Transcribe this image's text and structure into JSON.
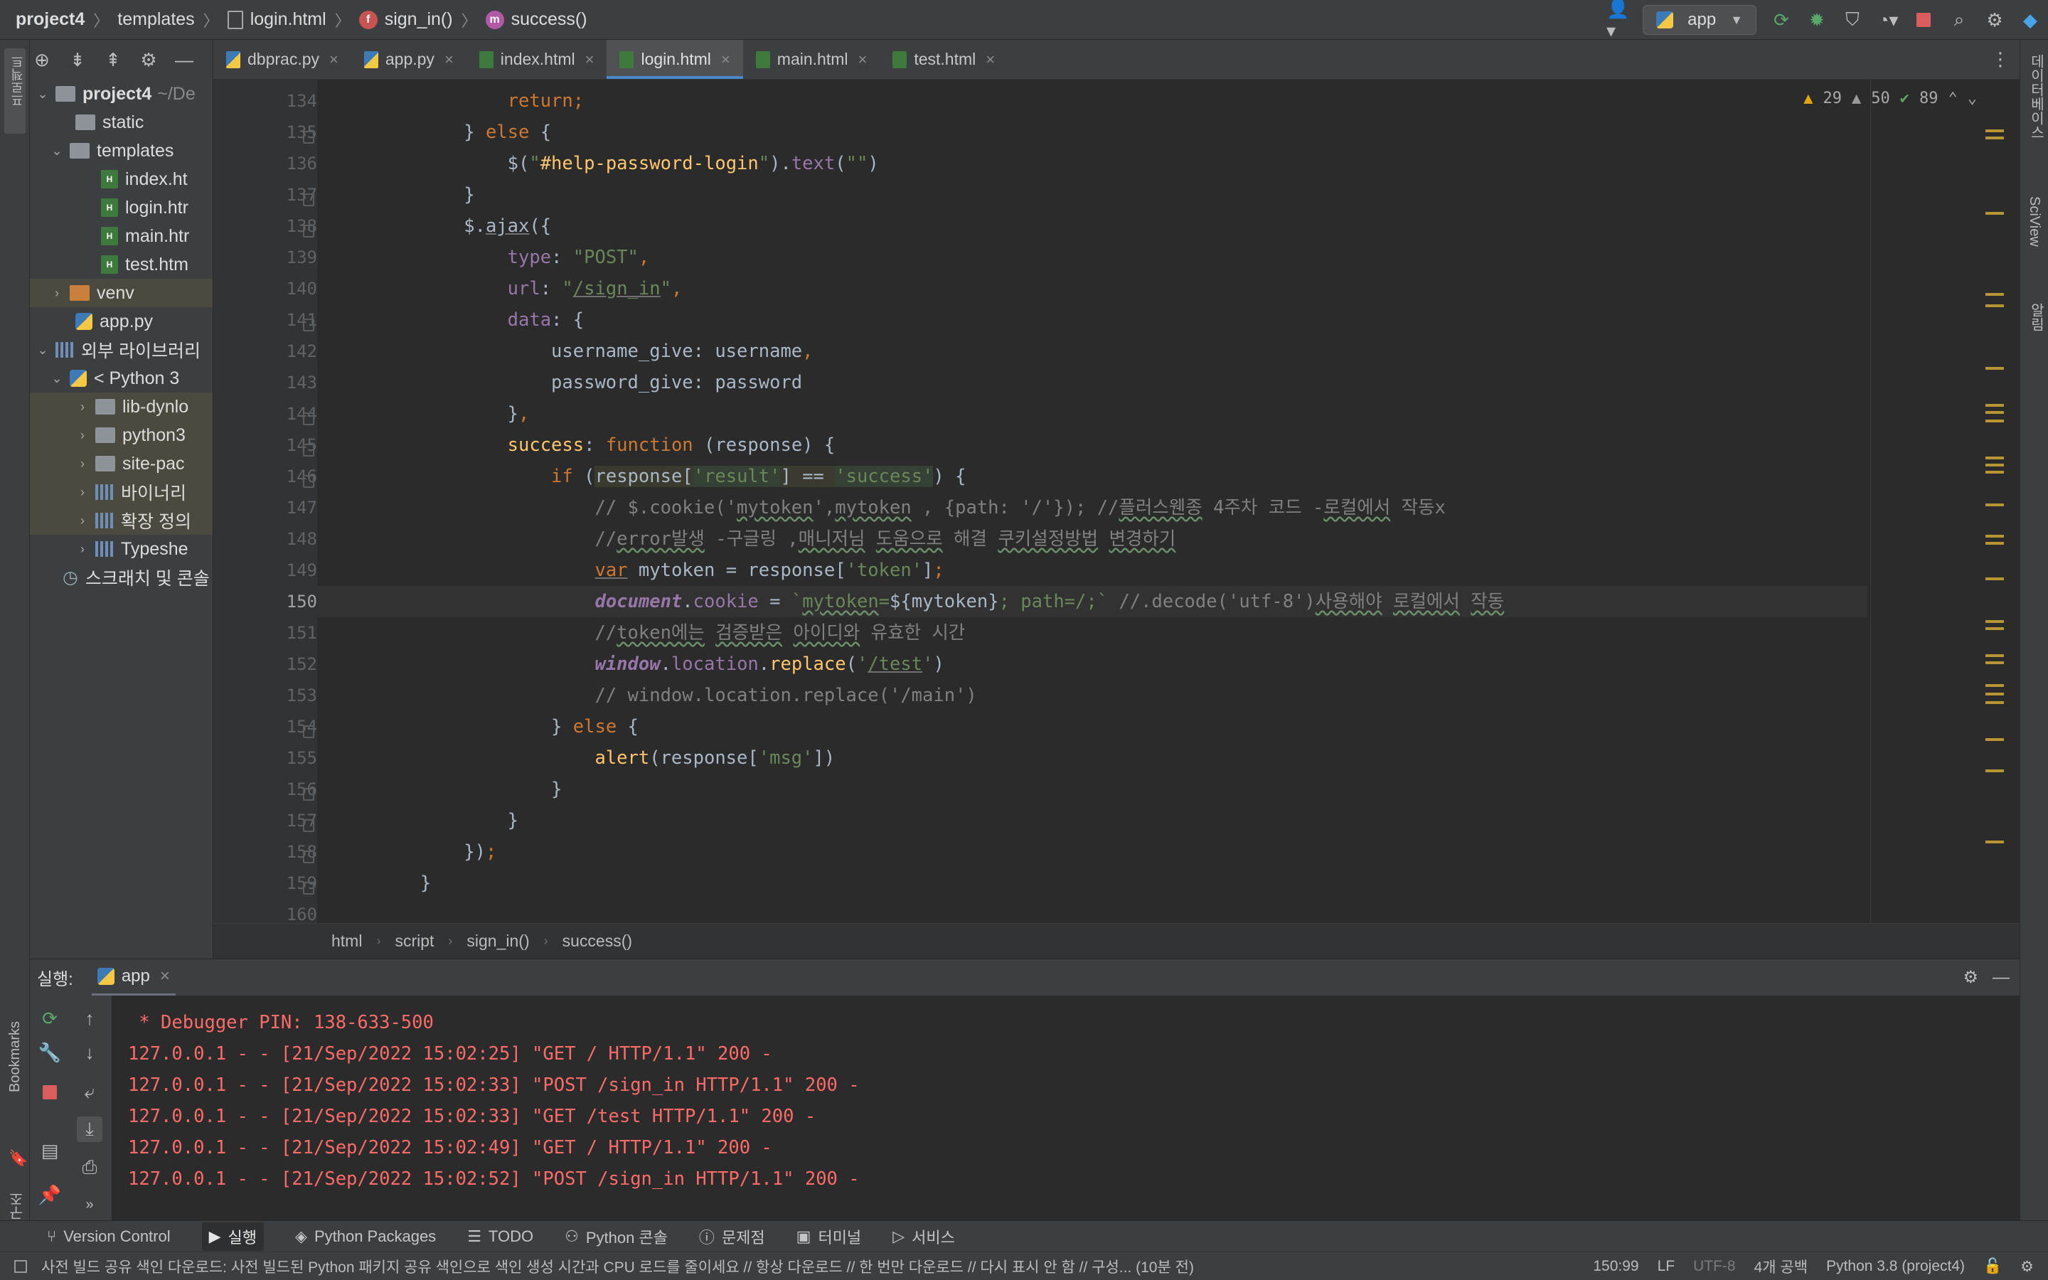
{
  "breadcrumb": {
    "project": "project4",
    "folder": "templates",
    "file": "login.html",
    "function_badge": "f",
    "function": "sign_in()",
    "method_badge": "m",
    "method": "success()"
  },
  "run_config": {
    "label": "app"
  },
  "project_panel": {
    "vertical_label": "프로젝트",
    "tree": [
      {
        "label": "project4",
        "suffix": "~/De"
      },
      {
        "label": "static"
      },
      {
        "label": "templates"
      },
      {
        "label": "index.ht"
      },
      {
        "label": "login.htr"
      },
      {
        "label": "main.htr"
      },
      {
        "label": "test.htm"
      },
      {
        "label": "venv"
      },
      {
        "label": "app.py"
      },
      {
        "label": "외부 라이브러리"
      },
      {
        "label": "< Python 3"
      },
      {
        "label": "lib-dynlo"
      },
      {
        "label": "python3"
      },
      {
        "label": "site-pac"
      },
      {
        "label": "바이너리"
      },
      {
        "label": "확장 정의"
      },
      {
        "label": "Typeshe"
      },
      {
        "label": "스크래치 및 콘솔"
      }
    ]
  },
  "tabs": [
    {
      "label": "dbprac.py",
      "type": "py"
    },
    {
      "label": "app.py",
      "type": "py"
    },
    {
      "label": "index.html",
      "type": "html"
    },
    {
      "label": "login.html",
      "type": "html",
      "active": true
    },
    {
      "label": "main.html",
      "type": "html"
    },
    {
      "label": "test.html",
      "type": "html"
    }
  ],
  "inspections": {
    "warnings_a": "29",
    "warnings_b": "50",
    "ok": "89"
  },
  "editor": {
    "line_numbers": [
      "134",
      "135",
      "136",
      "137",
      "138",
      "139",
      "140",
      "141",
      "142",
      "143",
      "144",
      "145",
      "146",
      "147",
      "148",
      "149",
      "150",
      "151",
      "152",
      "153",
      "154",
      "155",
      "156",
      "157",
      "158",
      "159",
      "160"
    ],
    "current_line": "150",
    "lines": [
      {
        "t": [
          [
            "k",
            "                return;"
          ]
        ]
      },
      {
        "t": [
          [
            "",
            "            } "
          ],
          [
            "k",
            "else"
          ],
          [
            "",
            " {"
          ]
        ]
      },
      {
        "t": [
          [
            "",
            "                $("
          ],
          [
            "s",
            "\""
          ],
          [
            "attr",
            "#help-password-login"
          ],
          [
            "s",
            "\""
          ],
          [
            "",
            ")."
          ],
          [
            "p",
            "text"
          ],
          [
            "",
            "("
          ],
          [
            "s",
            "\"\""
          ],
          [
            "",
            ")"
          ]
        ]
      },
      {
        "t": [
          [
            "",
            "            }"
          ]
        ]
      },
      {
        "t": [
          [
            "",
            "            $."
          ],
          [
            "u",
            "ajax"
          ],
          [
            "",
            "({"
          ]
        ]
      },
      {
        "t": [
          [
            "p",
            "                type"
          ],
          [
            "",
            ": "
          ],
          [
            "s",
            "\"POST\""
          ],
          [
            "k",
            ","
          ]
        ]
      },
      {
        "t": [
          [
            "p",
            "                url"
          ],
          [
            "",
            ": "
          ],
          [
            "s",
            "\""
          ],
          [
            "su",
            "/sign_in"
          ],
          [
            "s",
            "\""
          ],
          [
            "k",
            ","
          ]
        ]
      },
      {
        "t": [
          [
            "p",
            "                data"
          ],
          [
            "",
            ": {"
          ]
        ]
      },
      {
        "t": [
          [
            "",
            "                    username_give: username"
          ],
          [
            "k",
            ","
          ]
        ]
      },
      {
        "t": [
          [
            "",
            "                    password_give: password"
          ]
        ]
      },
      {
        "t": [
          [
            "",
            "                }"
          ],
          [
            "k",
            ","
          ]
        ]
      },
      {
        "t": [
          [
            "f",
            "                success"
          ],
          [
            "",
            ": "
          ],
          [
            "k",
            "function"
          ],
          [
            "",
            " (response) {"
          ]
        ]
      },
      {
        "t": [
          [
            "k",
            "                    if"
          ],
          [
            "",
            " ("
          ],
          [
            "h",
            "response["
          ],
          [
            "hs",
            "'result'"
          ],
          [
            "h",
            "] == "
          ],
          [
            "hs",
            "'success'"
          ],
          [
            "",
            ") {"
          ]
        ]
      },
      {
        "t": [
          [
            "c",
            "                        // $.cookie('"
          ],
          [
            "cw",
            "mytoken"
          ],
          [
            "c",
            "',"
          ],
          [
            "cw",
            "mytoken"
          ],
          [
            "c",
            " , {path: '/'}); //"
          ],
          [
            "cw",
            "플러스웬종"
          ],
          [
            "c",
            " 4주차 코드 -"
          ],
          [
            "cw",
            "로컬에서"
          ],
          [
            "c",
            " 작동x"
          ]
        ]
      },
      {
        "t": [
          [
            "c",
            "                        //"
          ],
          [
            "cw",
            "error발생"
          ],
          [
            "c",
            " -구글링 ,"
          ],
          [
            "cw",
            "매니저님"
          ],
          [
            "c",
            " "
          ],
          [
            "cw",
            "도움으로"
          ],
          [
            "c",
            " 해결 "
          ],
          [
            "cw",
            "쿠키설정방법"
          ],
          [
            "c",
            " "
          ],
          [
            "cw",
            "변경하기"
          ]
        ]
      },
      {
        "t": [
          [
            "k",
            "                        "
          ],
          [
            "ku",
            "var"
          ],
          [
            "",
            " mytoken = response["
          ],
          [
            "s",
            "'token'"
          ],
          [
            "",
            "]"
          ],
          [
            "k",
            ";"
          ]
        ]
      },
      {
        "t": [
          [
            "",
            "                        "
          ],
          [
            "g",
            "document"
          ],
          [
            "",
            "."
          ],
          [
            "p",
            "cookie"
          ],
          [
            "",
            " = "
          ],
          [
            "s",
            "`"
          ],
          [
            "sw",
            "mytoken"
          ],
          [
            "s",
            "="
          ],
          [
            "",
            "${mytoken}"
          ],
          [
            "s",
            "; path=/;`"
          ],
          [
            "c",
            " //.decode('utf-8')"
          ],
          [
            "cw",
            "사용해야"
          ],
          [
            "c",
            " "
          ],
          [
            "cw",
            "로컬에서"
          ],
          [
            "c",
            " "
          ],
          [
            "cw",
            "작동"
          ]
        ]
      },
      {
        "t": [
          [
            "c",
            "                        //"
          ],
          [
            "cw",
            "token에는"
          ],
          [
            "c",
            " "
          ],
          [
            "cw",
            "검증받은"
          ],
          [
            "c",
            " "
          ],
          [
            "cw",
            "아이디와"
          ],
          [
            "c",
            " 유효한 시간"
          ]
        ]
      },
      {
        "t": [
          [
            "",
            "                        "
          ],
          [
            "g",
            "window"
          ],
          [
            "",
            "."
          ],
          [
            "p",
            "location"
          ],
          [
            "",
            "."
          ],
          [
            "f",
            "replace"
          ],
          [
            "",
            "("
          ],
          [
            "s",
            "'"
          ],
          [
            "su",
            "/test"
          ],
          [
            "s",
            "'"
          ],
          [
            "",
            ")"
          ]
        ]
      },
      {
        "t": [
          [
            "c",
            "                        // window.location.replace('/main')"
          ]
        ]
      },
      {
        "t": [
          [
            "",
            "                    } "
          ],
          [
            "k",
            "else"
          ],
          [
            "",
            " {"
          ]
        ]
      },
      {
        "t": [
          [
            "f",
            "                        alert"
          ],
          [
            "",
            "(response["
          ],
          [
            "s",
            "'msg'"
          ],
          [
            "",
            "])"
          ]
        ]
      },
      {
        "t": [
          [
            "",
            "                    }"
          ]
        ]
      },
      {
        "t": [
          [
            "",
            "                }"
          ]
        ]
      },
      {
        "t": [
          [
            "",
            "            })"
          ],
          [
            "k",
            ";"
          ]
        ]
      },
      {
        "t": [
          [
            "",
            "        }"
          ]
        ]
      },
      {
        "t": [
          [
            "",
            ""
          ]
        ]
      }
    ]
  },
  "editor_breadcrumb": [
    "html",
    "script",
    "sign_in()",
    "success()"
  ],
  "run_panel": {
    "label": "실행:",
    "tab": "app",
    "console": [
      " * Debugger PIN: 138-633-500",
      "127.0.0.1 - - [21/Sep/2022 15:02:25] \"GET / HTTP/1.1\" 200 -",
      "127.0.0.1 - - [21/Sep/2022 15:02:33] \"POST /sign_in HTTP/1.1\" 200 -",
      "127.0.0.1 - - [21/Sep/2022 15:02:33] \"GET /test HTTP/1.1\" 200 -",
      "127.0.0.1 - - [21/Sep/2022 15:02:49] \"GET / HTTP/1.1\" 200 -",
      "127.0.0.1 - - [21/Sep/2022 15:02:52] \"POST /sign_in HTTP/1.1\" 200 -"
    ]
  },
  "left_stripe": {
    "bookmarks": "Bookmarks",
    "structure": "구조"
  },
  "right_stripe": {
    "database": "데이터베이스",
    "sciview": "SciView",
    "notifications": "알림"
  },
  "tool_windows": [
    {
      "label": "Version Control"
    },
    {
      "label": "실행",
      "active": true
    },
    {
      "label": "Python Packages"
    },
    {
      "label": "TODO"
    },
    {
      "label": "Python 콘솔"
    },
    {
      "label": "문제점"
    },
    {
      "label": "터미널"
    },
    {
      "label": "서비스"
    }
  ],
  "status": {
    "message": "사전 빌드 공유 색인 다운로드: 사전 빌드된 Python 패키지 공유 색인으로 색인 생성 시간과 CPU 로드를 줄이세요 // 항상 다운로드 // 한 번만 다운로드 // 다시 표시 안 함 // 구성... (10분 전)",
    "position": "150:99",
    "line_sep": "LF",
    "encoding": "UTF-8",
    "indent": "4개 공백",
    "interpreter": "Python 3.8 (project4)"
  },
  "colors": {
    "accent": "#4a88c7",
    "keyword": "#cc7832",
    "string": "#6a8759",
    "console_error": "#ff6b68"
  }
}
